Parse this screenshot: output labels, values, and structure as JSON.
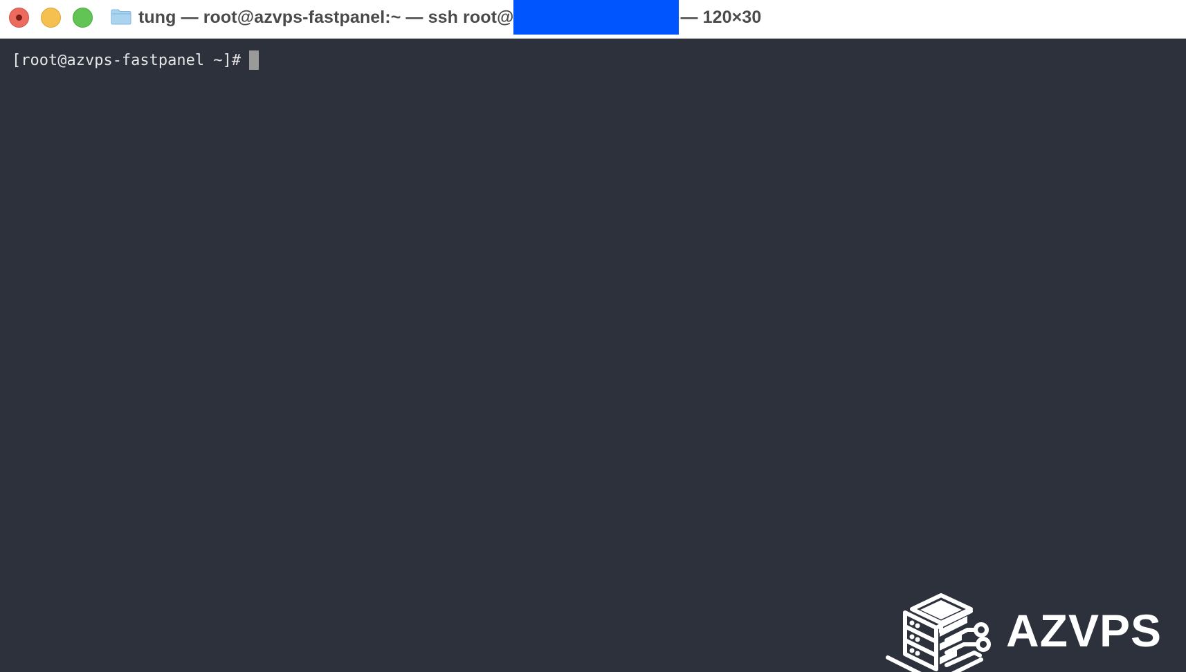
{
  "window": {
    "title_prefix": "tung — root@azvps-fastpanel:~ — ssh root@",
    "title_suffix": "— 120×30",
    "folder_icon": "folder-icon",
    "traffic_lights": {
      "close_color": "#ed6a5e",
      "minimize_color": "#f5c04f",
      "zoom_color": "#61c454"
    },
    "redaction_color": "#0055ff"
  },
  "terminal": {
    "background": "#2d313c",
    "prompt": "[root@azvps-fastpanel ~]#"
  },
  "watermark": {
    "logo_text": "AZVPS",
    "logo_icon": "server-stack-icon"
  }
}
